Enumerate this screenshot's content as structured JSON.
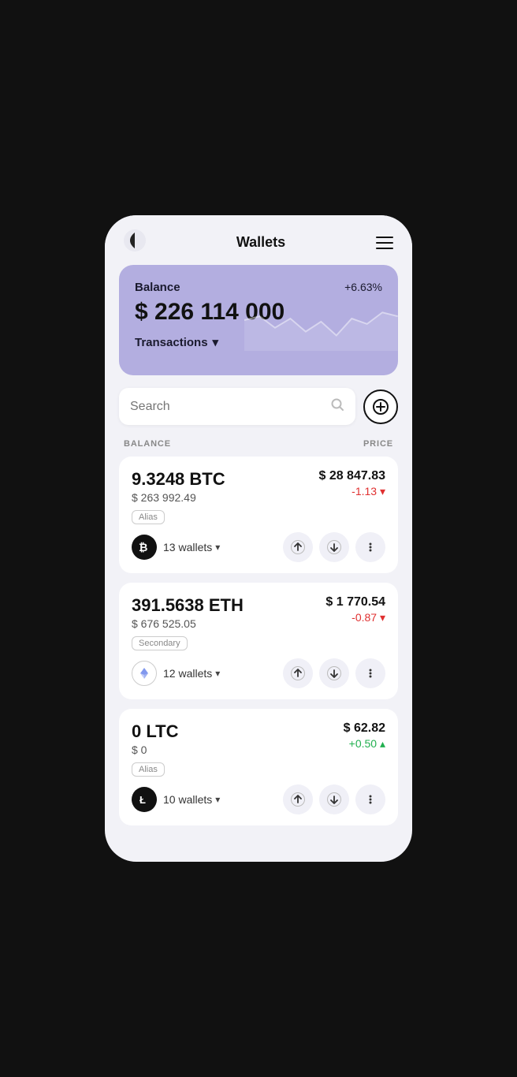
{
  "app": {
    "title": "Wallets"
  },
  "balance_card": {
    "label": "Balance",
    "amount": "$ 226 114 000",
    "percent": "+6.63%",
    "transactions_label": "Transactions"
  },
  "search": {
    "placeholder": "Search"
  },
  "list_headers": {
    "balance": "BALANCE",
    "price": "PRICE"
  },
  "coins": [
    {
      "balance": "9.3248 BTC",
      "usd_value": "$ 263 992.49",
      "alias": "Alias",
      "wallets": "13 wallets",
      "price": "$ 28 847.83",
      "change": "-1.13",
      "change_type": "neg",
      "symbol": "BTC"
    },
    {
      "balance": "391.5638 ETH",
      "usd_value": "$ 676 525.05",
      "alias": "Secondary",
      "wallets": "12 wallets",
      "price": "$ 1 770.54",
      "change": "-0.87",
      "change_type": "neg",
      "symbol": "ETH"
    },
    {
      "balance": "0 LTC",
      "usd_value": "$ 0",
      "alias": "Alias",
      "wallets": "10 wallets",
      "price": "$ 62.82",
      "change": "+0.50",
      "change_type": "pos",
      "symbol": "LTC"
    }
  ]
}
